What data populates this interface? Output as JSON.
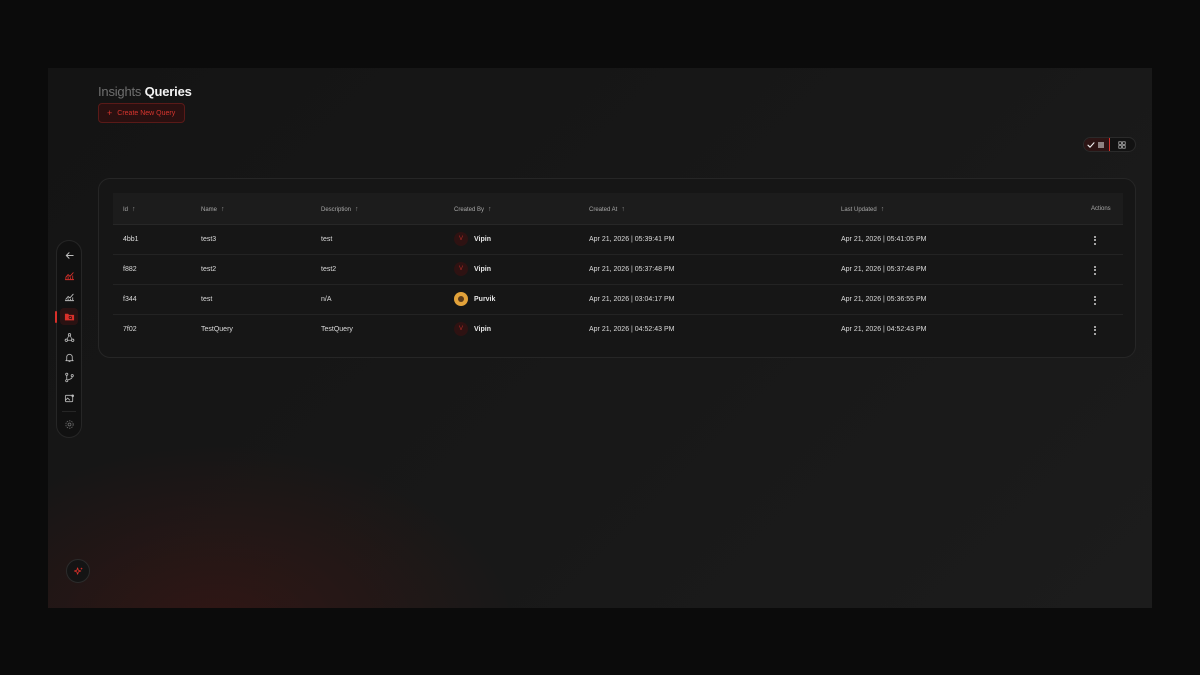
{
  "header": {
    "title_prefix": "Insights",
    "title_main": "Queries",
    "create_button": "Create New Query",
    "create_icon": "+"
  },
  "view_toggle": {
    "selected": "list",
    "options": [
      "list",
      "grid"
    ]
  },
  "sidebar": {
    "items": [
      {
        "icon": "back-arrow-icon",
        "active": false
      },
      {
        "icon": "analytics-chart-icon",
        "active": false
      },
      {
        "icon": "line-chart-icon",
        "active": false
      },
      {
        "icon": "queries-folder-icon",
        "active": true
      },
      {
        "icon": "network-nodes-icon",
        "active": false
      },
      {
        "icon": "bell-icon",
        "active": false
      },
      {
        "icon": "git-branch-icon",
        "active": false
      },
      {
        "icon": "image-icon",
        "active": false
      },
      {
        "icon": "settings-icon",
        "active": false
      }
    ]
  },
  "table": {
    "columns": [
      "Id",
      "Name",
      "Description",
      "Created By",
      "Created At",
      "Last Updated",
      "Actions"
    ],
    "rows": [
      {
        "id": "4bb1",
        "name": "test3",
        "description": "test",
        "created_by": "Vipin",
        "avatar": "V",
        "created_at": "Apr 21, 2026 | 05:39:41 PM",
        "last_updated": "Apr 21, 2026 | 05:41:05 PM"
      },
      {
        "id": "f882",
        "name": "test2",
        "description": "test2",
        "created_by": "Vipin",
        "avatar": "V",
        "created_at": "Apr 21, 2026 | 05:37:48 PM",
        "last_updated": "Apr 21, 2026 | 05:37:48 PM"
      },
      {
        "id": "f344",
        "name": "test",
        "description": "n/A",
        "created_by": "Purvik",
        "avatar": "",
        "created_at": "Apr 21, 2026 | 03:04:17 PM",
        "last_updated": "Apr 21, 2026 | 05:36:55 PM"
      },
      {
        "id": "7f02",
        "name": "TestQuery",
        "description": "TestQuery",
        "created_by": "Vipin",
        "avatar": "V",
        "created_at": "Apr 21, 2026 | 04:52:43 PM",
        "last_updated": "Apr 21, 2026 | 04:52:43 PM"
      }
    ]
  },
  "colors": {
    "accent": "#d8302a",
    "background": "#0b0b0b",
    "card": "#161616"
  }
}
